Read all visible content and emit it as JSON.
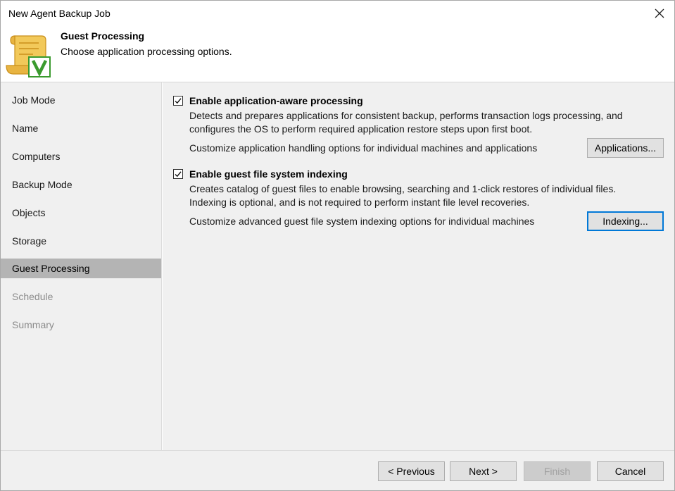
{
  "window": {
    "title": "New Agent Backup Job"
  },
  "header": {
    "title": "Guest Processing",
    "subtitle": "Choose application processing options."
  },
  "sidebar": {
    "items": [
      {
        "label": "Job Mode",
        "state": "normal"
      },
      {
        "label": "Name",
        "state": "normal"
      },
      {
        "label": "Computers",
        "state": "normal"
      },
      {
        "label": "Backup Mode",
        "state": "normal"
      },
      {
        "label": "Objects",
        "state": "normal"
      },
      {
        "label": "Storage",
        "state": "normal"
      },
      {
        "label": "Guest Processing",
        "state": "active"
      },
      {
        "label": "Schedule",
        "state": "disabled"
      },
      {
        "label": "Summary",
        "state": "disabled"
      }
    ]
  },
  "main": {
    "app_aware": {
      "checked": true,
      "label": "Enable application-aware processing",
      "desc_line1": "Detects and prepares applications for consistent backup, performs transaction logs processing, and",
      "desc_line2": "configures the OS to perform required application restore steps upon first boot.",
      "customize_text": "Customize application handling options for individual machines and applications",
      "button_label": "Applications..."
    },
    "indexing": {
      "checked": true,
      "label": "Enable guest file system indexing",
      "desc_line1": "Creates catalog of guest files to enable browsing, searching and 1-click restores of individual files.",
      "desc_line2": "Indexing is optional, and is not required to perform instant file level recoveries.",
      "customize_text": "Customize advanced guest file system indexing options for individual machines",
      "button_label": "Indexing..."
    }
  },
  "footer": {
    "previous_label": "< Previous",
    "next_label": "Next >",
    "finish_label": "Finish",
    "cancel_label": "Cancel"
  },
  "icons": {
    "close": "close-icon",
    "logo": "veeam-scroll-logo",
    "checkmark": "checkmark-icon"
  },
  "colors": {
    "accent": "#0078d7",
    "sidebar_active": "#b4b4b4",
    "logo_gold": "#e8b441",
    "logo_green": "#3a9a2e"
  }
}
